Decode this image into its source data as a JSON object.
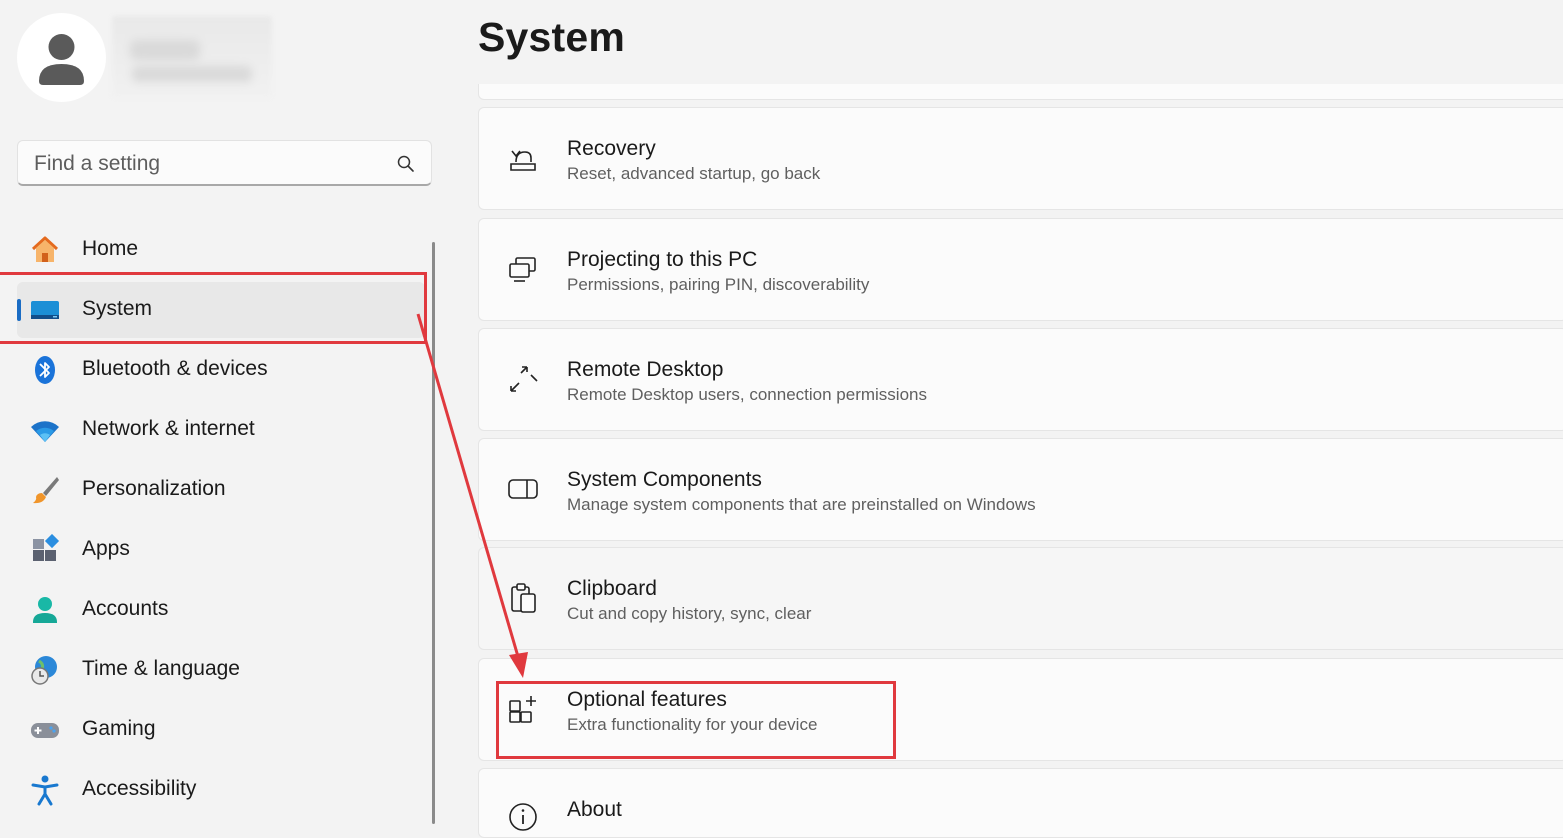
{
  "sidebar": {
    "search_placeholder": "Find a setting",
    "items": [
      {
        "label": "Home",
        "icon": "home-icon"
      },
      {
        "label": "System",
        "icon": "system-display-icon",
        "selected": true
      },
      {
        "label": "Bluetooth & devices",
        "icon": "bluetooth-icon"
      },
      {
        "label": "Network & internet",
        "icon": "wifi-icon"
      },
      {
        "label": "Personalization",
        "icon": "paintbrush-icon"
      },
      {
        "label": "Apps",
        "icon": "apps-icon"
      },
      {
        "label": "Accounts",
        "icon": "accounts-person-icon"
      },
      {
        "label": "Time & language",
        "icon": "globe-clock-icon"
      },
      {
        "label": "Gaming",
        "icon": "gamepad-icon"
      },
      {
        "label": "Accessibility",
        "icon": "accessibility-person-icon"
      }
    ]
  },
  "main": {
    "title": "System",
    "cards": [
      {
        "title": "Recovery",
        "subtitle": "Reset, advanced startup, go back",
        "icon": "recovery-icon"
      },
      {
        "title": "Projecting to this PC",
        "subtitle": "Permissions, pairing PIN, discoverability",
        "icon": "projecting-icon"
      },
      {
        "title": "Remote Desktop",
        "subtitle": "Remote Desktop users, connection permissions",
        "icon": "remote-desktop-icon"
      },
      {
        "title": "System Components",
        "subtitle": "Manage system components that are preinstalled on Windows",
        "icon": "system-components-icon"
      },
      {
        "title": "Clipboard",
        "subtitle": "Cut and copy history, sync, clear",
        "icon": "clipboard-icon"
      },
      {
        "title": "Optional features",
        "subtitle": "Extra functionality for your device",
        "icon": "optional-features-icon"
      },
      {
        "title": "About",
        "subtitle": "",
        "icon": "info-icon"
      }
    ]
  },
  "colors": {
    "accent": "#1a6cc4",
    "annotation": "#e0393e",
    "background": "#f3f3f3",
    "card": "#fbfbfb"
  }
}
